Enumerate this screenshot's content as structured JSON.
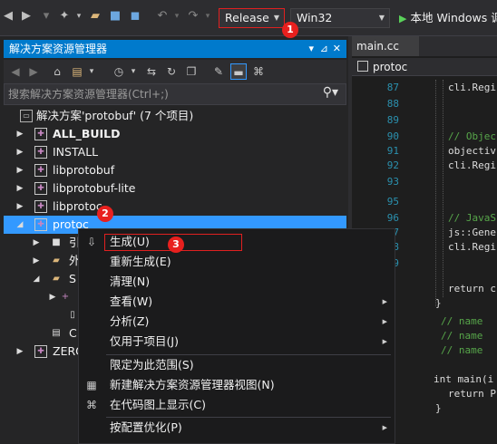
{
  "toolbar": {
    "config": "Release",
    "platform": "Win32",
    "run_label": "本地 Windows 调",
    "icons": [
      "back-icon",
      "forward-icon",
      "new-project-icon",
      "open-icon",
      "save-icon",
      "save-all-icon",
      "undo-icon",
      "redo-icon"
    ]
  },
  "badges": {
    "one": "1",
    "two": "2",
    "three": "3"
  },
  "panel": {
    "title": "解决方案资源管理器",
    "pin": "▾ ⊿",
    "close": "✕",
    "search_placeholder": "搜索解决方案资源管理器(Ctrl+;)"
  },
  "tree": {
    "solution": "解决方案'protobuf' (7 个项目)",
    "items": [
      {
        "label": "ALL_BUILD",
        "bold": true
      },
      {
        "label": "INSTALL"
      },
      {
        "label": "libprotobuf"
      },
      {
        "label": "libprotobuf-lite"
      },
      {
        "label": "libprotoc"
      },
      {
        "label": "protoc"
      }
    ],
    "children": [
      {
        "label": "引"
      },
      {
        "label": "外"
      },
      {
        "label": "S"
      },
      {
        "label": ""
      },
      {
        "label": ""
      },
      {
        "label": "C"
      }
    ],
    "last": "ZERO"
  },
  "editor": {
    "tab": "main.cc",
    "nav": "protoc",
    "lines": [
      {
        "n": "87",
        "text": "cli.Regi"
      },
      {
        "n": "88",
        "text": ""
      },
      {
        "n": "89",
        "text": ""
      },
      {
        "n": "90",
        "text": "// Objec"
      },
      {
        "n": "91",
        "text": "objectiv"
      },
      {
        "n": "92",
        "text": "cli.Regi"
      },
      {
        "n": "93",
        "text": ""
      },
      {
        "n": "95",
        "text": ""
      },
      {
        "n": "96",
        "text": "// JavaS"
      },
      {
        "n": "97",
        "text": "js::Gene"
      },
      {
        "n": "98",
        "text": "cli.Regi"
      },
      {
        "n": "99",
        "text": ""
      },
      {
        "n": "",
        "text": ""
      },
      {
        "n": "",
        "text": "return c"
      },
      {
        "n": "",
        "text": "}"
      },
      {
        "n": "",
        "text": ""
      },
      {
        "n": "",
        "text": "// name"
      },
      {
        "n": "",
        "text": "// name"
      },
      {
        "n": "",
        "text": "// name"
      },
      {
        "n": "",
        "text": ""
      },
      {
        "n": "",
        "text": "int main(i"
      },
      {
        "n": "",
        "text": "return P"
      },
      {
        "n": "",
        "text": "}"
      }
    ]
  },
  "menu": {
    "items": [
      {
        "label": "生成(U)",
        "icon": "build-icon"
      },
      {
        "label": "重新生成(E)"
      },
      {
        "label": "清理(N)"
      },
      {
        "label": "查看(W)",
        "sub": true
      },
      {
        "label": "分析(Z)",
        "sub": true
      },
      {
        "label": "仅用于项目(J)",
        "sub": true
      },
      {
        "label": "限定为此范围(S)"
      },
      {
        "label": "新建解决方案资源管理器视图(N)",
        "icon": "new-view-icon"
      },
      {
        "label": "在代码图上显示(C)",
        "icon": "code-map-icon"
      },
      {
        "label": "按配置优化(P)",
        "sub": true
      }
    ]
  },
  "colors": {
    "accent": "#007acc",
    "selection": "#3399ff",
    "highlight": "#e02020"
  }
}
